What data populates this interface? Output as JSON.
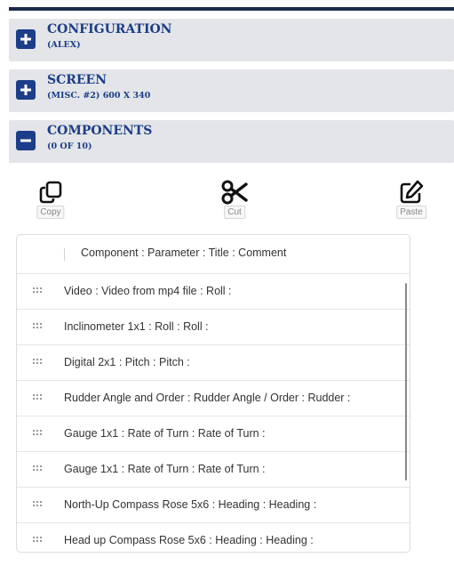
{
  "sections": [
    {
      "title": "CONFIGURATION",
      "subtitle": "(ALEX)",
      "state": "collapsed",
      "toggle_icon": "plus-icon"
    },
    {
      "title": "SCREEN",
      "subtitle": "(MISC. #2) 600 X 340",
      "state": "collapsed",
      "toggle_icon": "plus-icon"
    },
    {
      "title": "COMPONENTS",
      "subtitle": "(0 OF 10)",
      "state": "expanded",
      "toggle_icon": "minus-icon"
    }
  ],
  "toolbar": {
    "copy_label": "Copy",
    "cut_label": "Cut",
    "paste_label": "Paste"
  },
  "list": {
    "header": "Component : Parameter : Title : Comment",
    "items": [
      "Video : Video from mp4 file : Roll :",
      "Inclinometer 1x1 : Roll : Roll :",
      "Digital 2x1 : Pitch : Pitch :",
      "Rudder Angle and Order : Rudder Angle / Order : Rudder :",
      "Gauge 1x1 : Rate of Turn : Rate of Turn :",
      "Gauge 1x1 : Rate of Turn : Rate of Turn :",
      "North-Up Compass Rose 5x6 : Heading : Heading :",
      "Head up Compass Rose 5x6 : Heading : Heading :"
    ]
  },
  "colors": {
    "accent": "#1c3d8a",
    "panel_bg": "#e3e5e8",
    "top_bar": "#1a2a4a"
  }
}
